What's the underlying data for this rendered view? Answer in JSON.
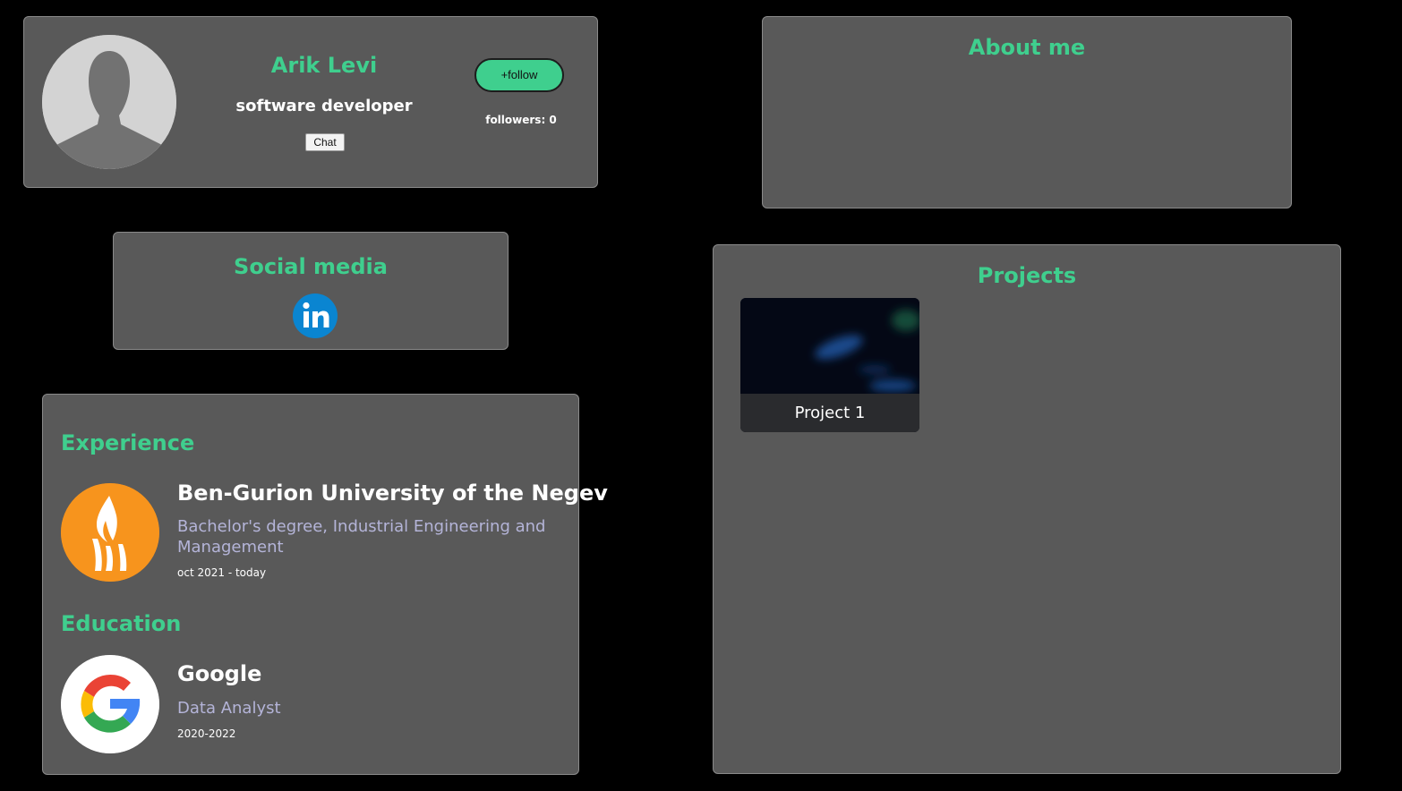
{
  "profile": {
    "name": "Arik Levi",
    "title": "software developer",
    "chat_label": "Chat",
    "follow_label": "+follow",
    "followers_text": "followers: 0"
  },
  "about": {
    "title": "About me"
  },
  "social": {
    "title": "Social media",
    "icons": [
      "linkedin-icon"
    ]
  },
  "experience": {
    "title": "Experience",
    "items": [
      {
        "name": "Ben-Gurion University of the Negev",
        "role": "Bachelor's degree, Industrial Engineering and Management",
        "dates": "oct 2021 - today",
        "logo": "bgu-logo"
      }
    ]
  },
  "education": {
    "title": "Education",
    "items": [
      {
        "name": "Google",
        "role": "Data Analyst",
        "dates": "2020-2022",
        "logo": "google-logo"
      }
    ]
  },
  "projects": {
    "title": "Projects",
    "items": [
      {
        "label": "Project 1"
      }
    ]
  },
  "colors": {
    "accent": "#3fcf8e",
    "card_bg": "#595959",
    "page_bg": "#000000",
    "subtitle": "#b4b4d8",
    "linkedin": "#0a85d1",
    "bgu_orange": "#f7941d"
  }
}
